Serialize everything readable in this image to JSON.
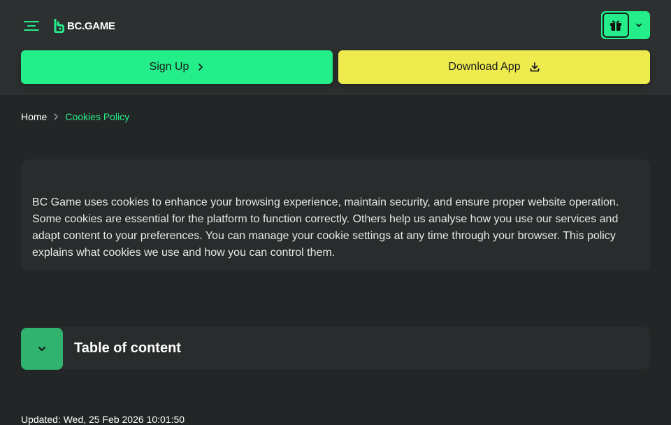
{
  "header": {
    "logo_text": "BC.GAME"
  },
  "actions": {
    "signup_label": "Sign Up",
    "download_label": "Download App"
  },
  "breadcrumb": {
    "home": "Home",
    "current": "Cookies Policy"
  },
  "intro": {
    "text": "BC Game uses cookies to enhance your browsing experience, maintain security, and ensure proper website operation. Some cookies are essential for the platform to function correctly. Others help us analyse how you use our services and adapt content to your preferences. You can manage your cookie settings at any time through your browser. This policy explains what cookies we use and how you can control them."
  },
  "toc": {
    "title": "Table of content"
  },
  "updated": {
    "text": "Updated: Wed, 25 Feb 2026 10:01:50"
  },
  "icons": {
    "menu": "menu-icon",
    "gift": "gift-icon",
    "chevron_down": "chevron-down-icon",
    "chevron_right": "chevron-right-icon",
    "download": "download-icon"
  },
  "colors": {
    "accent_green": "#24ee89",
    "accent_yellow": "#edeb4e",
    "background": "#232626",
    "surface": "#292c2c"
  }
}
